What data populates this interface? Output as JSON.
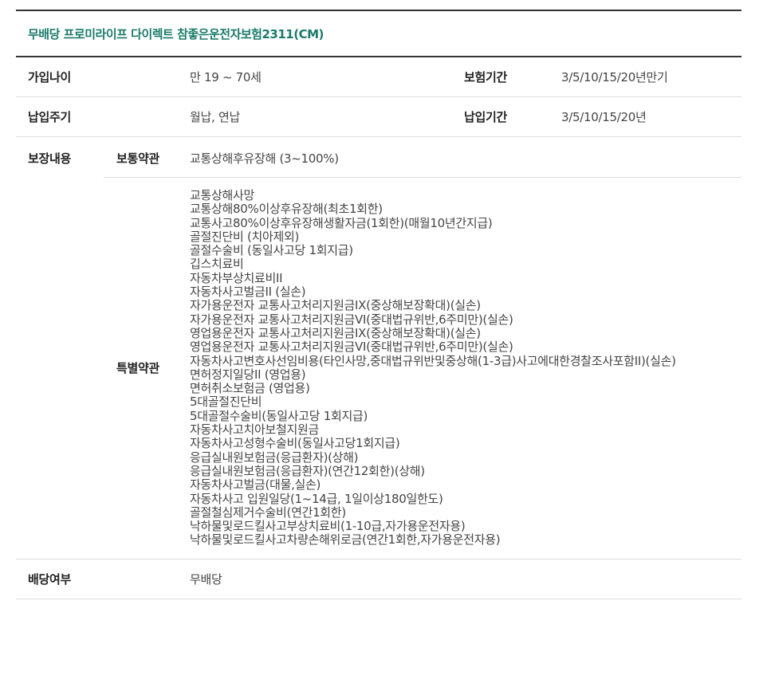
{
  "product": {
    "title": "무배당 프로미라이프 다이렉트 참좋은운전자보험2311(CM)"
  },
  "info": {
    "join_age_label": "가입나이",
    "join_age_value": "만 19 ~ 70세",
    "period_label": "보험기간",
    "period_value": "3/5/10/15/20년만기",
    "pay_cycle_label": "납입주기",
    "pay_cycle_value": "월납, 연납",
    "pay_period_label": "납입기간",
    "pay_period_value": "3/5/10/15/20년"
  },
  "coverage": {
    "label": "보장내용",
    "basic_label": "보통약관",
    "basic_value": "교통상해후유장해 (3~100%)",
    "special_label": "특별약관",
    "special_items": [
      "교통상해사망",
      "교통상해80%이상후유장해(최초1회한)",
      "교통사고80%이상후유장해생활자금(1회한)(매월10년간지급)",
      "골절진단비 (치아제외)",
      "골절수술비 (동일사고당 1회지급)",
      "깁스치료비",
      "자동차부상치료비II",
      "자동차사고벌금II (실손)",
      "자가용운전자 교통사고처리지원금IX(중상해보장확대)(실손)",
      "자가용운전자 교통사고처리지원금VI(중대법규위반,6주미만)(실손)",
      "영업용운전자 교통사고처리지원금IX(중상해보장확대)(실손)",
      "영업용운전자 교통사고처리지원금VI(중대법규위반,6주미만)(실손)",
      "자동차사고변호사선임비용(타인사망,중대법규위반및중상해(1-3급)사고에대한경찰조사포함II)(실손)",
      "면허정지일당II (영업용)",
      "면허취소보험금 (영업용)",
      "5대골절진단비",
      "5대골절수술비(동일사고당 1회지급)",
      "자동차사고치아보철지원금",
      "자동차사고성형수술비(동일사고당1회지급)",
      "응급실내원보험금(응급환자)(상해)",
      "응급실내원보험금(응급환자)(연간12회한)(상해)",
      "자동차사고벌금(대물,실손)",
      "자동차사고 입원일당(1~14급, 1일이상180일한도)",
      "골절철심제거수술비(연간1회한)",
      "낙하물및로드킬사고부상치료비(1-10급,자가용운전자용)",
      "낙하물및로드킬사고차량손해위로금(연간1회한,자가용운전자용)"
    ]
  },
  "dividend": {
    "label": "배당여부",
    "value": "무배당"
  },
  "colors": {
    "title_accent": "#1a7a6a",
    "border_dark": "#333333",
    "border_light": "#dcdcdc"
  }
}
